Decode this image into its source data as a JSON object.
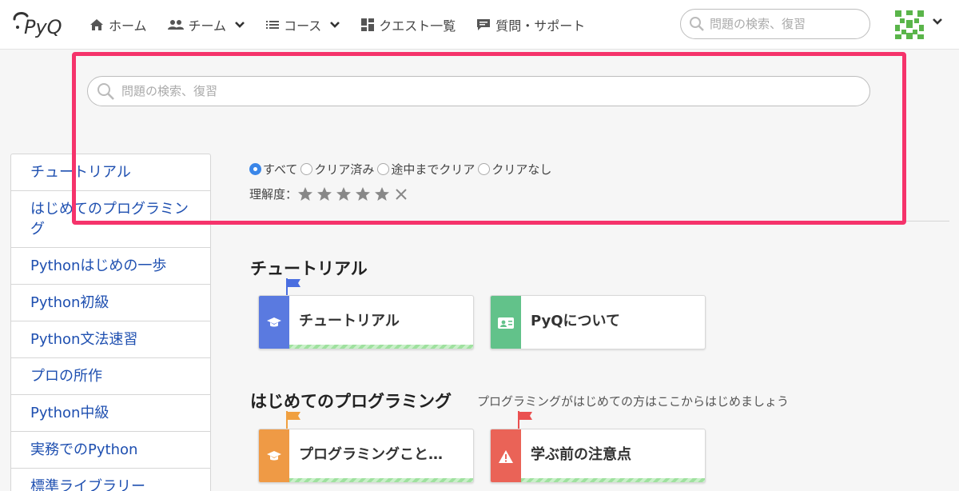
{
  "header": {
    "logo_text": "PyQ",
    "nav": [
      {
        "label": "ホーム",
        "icon": "home-icon"
      },
      {
        "label": "チーム",
        "icon": "people-icon",
        "dropdown": true
      },
      {
        "label": "コース",
        "icon": "list-icon",
        "dropdown": true
      },
      {
        "label": "クエスト一覧",
        "icon": "grid-icon"
      },
      {
        "label": "質問・サポート",
        "icon": "chat-icon"
      }
    ],
    "search_placeholder": "問題の検索、復習"
  },
  "main_search": {
    "placeholder": "問題の検索、復習"
  },
  "filters": {
    "options": [
      "すべて",
      "クリア済み",
      "途中までクリア",
      "クリアなし"
    ],
    "selected": "すべて",
    "rating_label": "理解度：",
    "rating_stars": 5
  },
  "sidebar": {
    "items": [
      "チュートリアル",
      "はじめてのプログラミング",
      "Pythonはじめの一歩",
      "Python初級",
      "Python文法速習",
      "プロの所作",
      "Python中級",
      "実務でのPython",
      "標準ライブラリー"
    ]
  },
  "sections": [
    {
      "title": "チュートリアル",
      "description": "",
      "cards": [
        {
          "label": "チュートリアル",
          "icon": "graduation-cap-icon",
          "color": "#5a7ae0",
          "flag_color": "#4a6ee0"
        },
        {
          "label": "PyQについて",
          "icon": "id-card-icon",
          "color": "#62c28a"
        }
      ]
    },
    {
      "title": "はじめてのプログラミング",
      "description": "プログラミングがはじめての方はここからはじめましょう",
      "cards": [
        {
          "label": "プログラミングこと…",
          "icon": "graduation-cap-icon",
          "color": "#ef9a45",
          "flag_color": "#f0a040"
        },
        {
          "label": "学ぶ前の注意点",
          "icon": "warning-icon",
          "color": "#ea6357",
          "flag_color": "#ea5050"
        }
      ]
    }
  ],
  "colors": {
    "highlight": "#f5336b",
    "link": "#1e4fb0",
    "radio_active": "#3a86e8"
  }
}
